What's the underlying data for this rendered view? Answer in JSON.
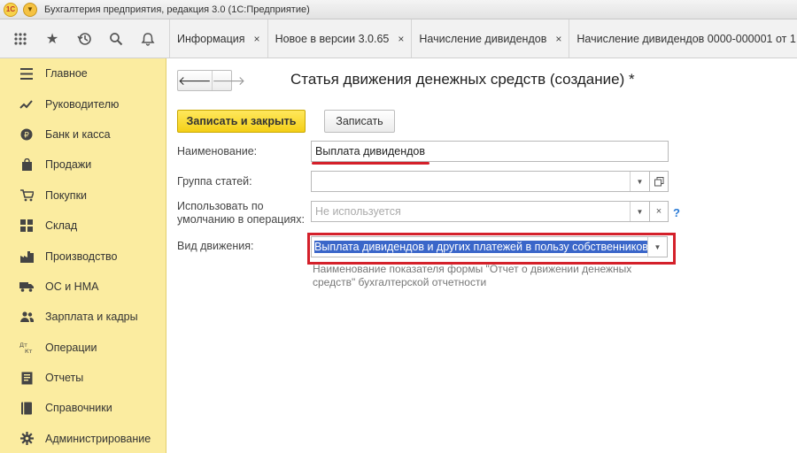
{
  "window": {
    "title": "Бухгалтерия предприятия, редакция 3.0  (1С:Предприятие)",
    "logo": "1С"
  },
  "toolbar_icons": [
    "apps-grid-icon",
    "star-icon",
    "history-icon",
    "search-icon",
    "bell-icon"
  ],
  "tabs": [
    {
      "label": "Информация",
      "close": "×"
    },
    {
      "label": "Новое в версии 3.0.65",
      "close": "×"
    },
    {
      "label": "Начисление дивидендов",
      "close": "×"
    },
    {
      "label": "Начисление дивидендов 0000-000001 от 1"
    }
  ],
  "sidebar": {
    "items": [
      {
        "label": "Главное",
        "icon": "menu-lines-icon"
      },
      {
        "label": "Руководителю",
        "icon": "trend-chart-icon"
      },
      {
        "label": "Банк и касса",
        "icon": "coin-icon"
      },
      {
        "label": "Продажи",
        "icon": "shopping-bag-icon"
      },
      {
        "label": "Покупки",
        "icon": "cart-icon"
      },
      {
        "label": "Склад",
        "icon": "warehouse-grid-icon"
      },
      {
        "label": "Производство",
        "icon": "factory-icon"
      },
      {
        "label": "ОС и НМА",
        "icon": "truck-icon"
      },
      {
        "label": "Зарплата и кадры",
        "icon": "people-icon"
      },
      {
        "label": "Операции",
        "icon": "dt-kt-icon"
      },
      {
        "label": "Отчеты",
        "icon": "report-icon"
      },
      {
        "label": "Справочники",
        "icon": "book-icon"
      },
      {
        "label": "Администрирование",
        "icon": "gear-icon"
      }
    ]
  },
  "form": {
    "title": "Статья движения денежных средств (создание) *",
    "save_close_label": "Записать и закрыть",
    "save_label": "Записать",
    "fields": {
      "name": {
        "label": "Наименование:",
        "value": "Выплата дивидендов"
      },
      "group": {
        "label": "Группа статей:",
        "value": ""
      },
      "default_use": {
        "label": "Использовать по умолчанию в операциях:",
        "placeholder": "Не используется"
      },
      "movement_type": {
        "label": "Вид движения:",
        "value": "Выплата дивидендов и других платежей в пользу собственников"
      }
    },
    "hint": "Наименование показателя формы \"Отчет о движении денежных средств\" бухгалтерской отчетности",
    "help": "?"
  },
  "colors": {
    "sidebar_bg": "#fbeca0",
    "primary_button": "#f4cf17",
    "highlight_red": "#d4202a",
    "selection_blue": "#3a66c9"
  }
}
